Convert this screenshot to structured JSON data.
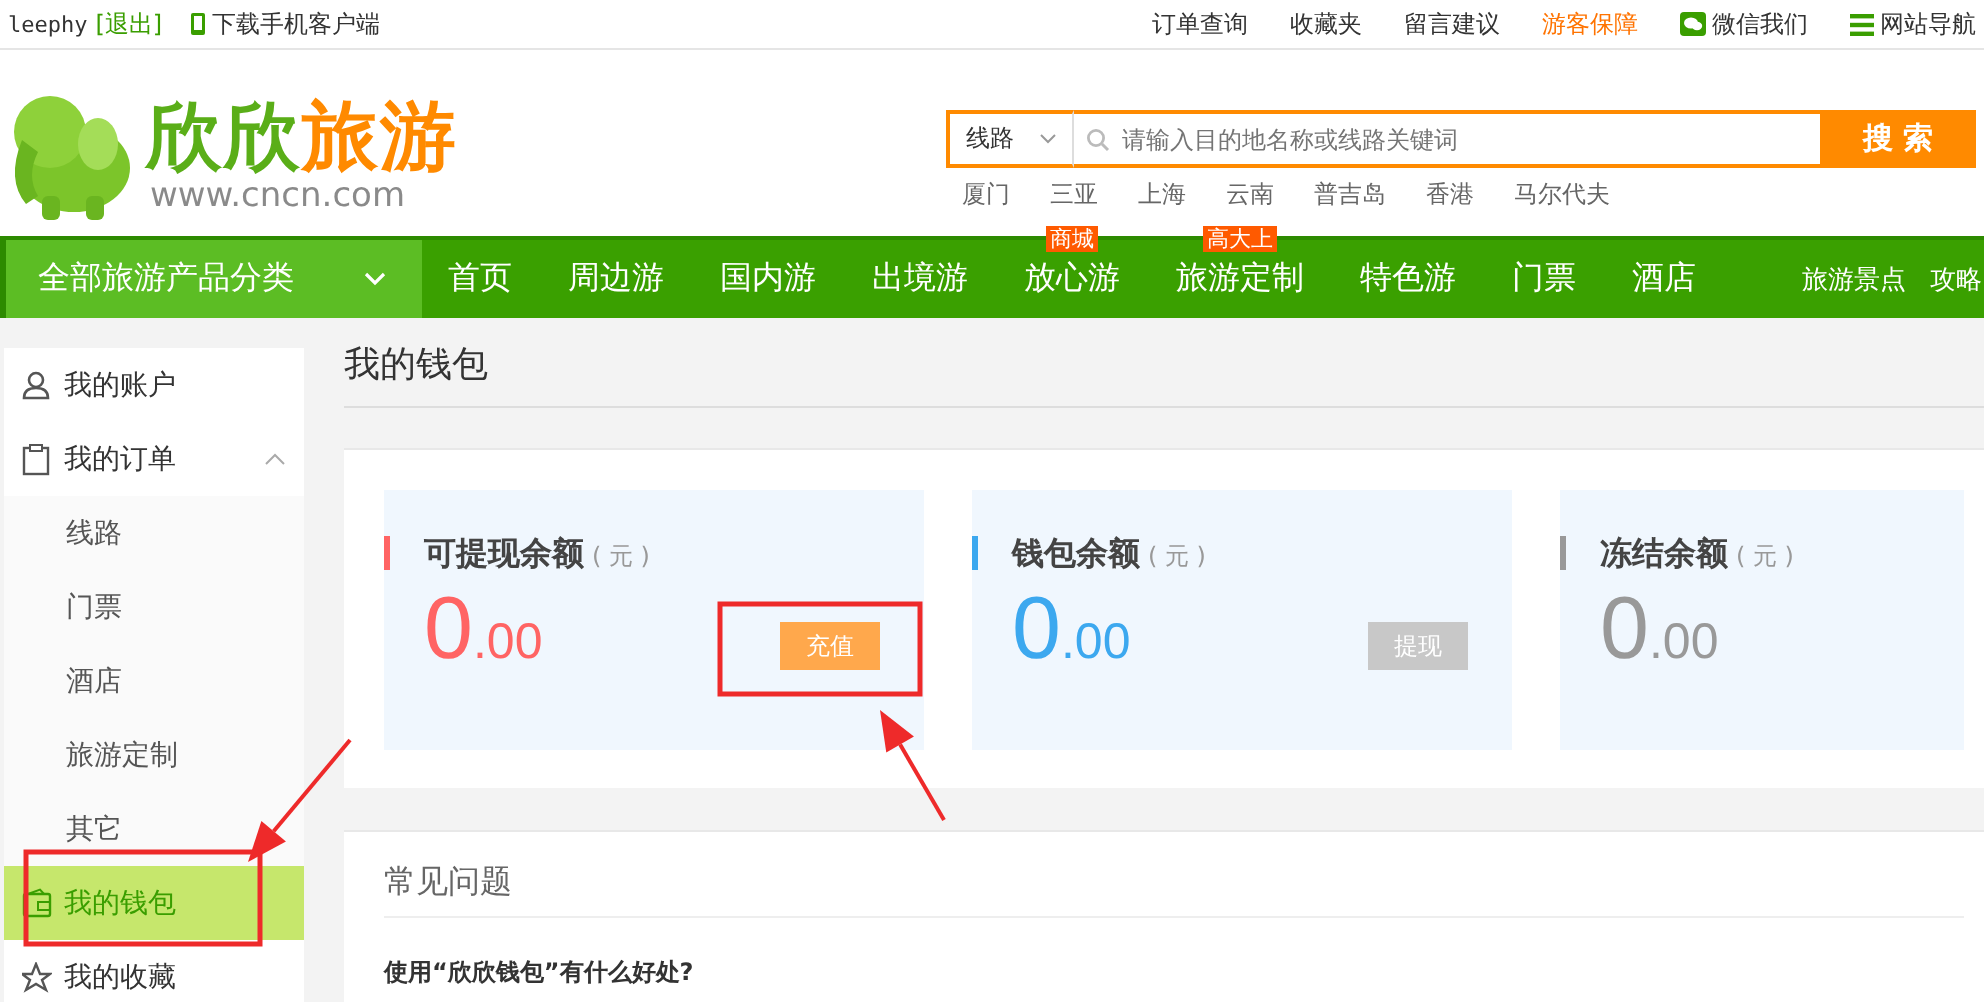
{
  "top_bar": {
    "username": "leephy",
    "logout": "[退出]",
    "app_download": "下载手机客户端",
    "links": [
      {
        "label": "订单查询",
        "kind": "plain"
      },
      {
        "label": "收藏夹",
        "kind": "plain"
      },
      {
        "label": "留言建议",
        "kind": "plain"
      },
      {
        "label": "游客保障",
        "kind": "highlight"
      },
      {
        "label": "微信我们",
        "kind": "wechat"
      },
      {
        "label": "网站导航",
        "kind": "menu"
      }
    ]
  },
  "header": {
    "logo": {
      "title_a": "欣欣",
      "title_b": "旅游",
      "domain": "www.cncn.com"
    },
    "search": {
      "category": "线路",
      "placeholder": "请输入目的地名称或线路关键词",
      "button": "搜 索"
    },
    "hot_words": [
      "厦门",
      "三亚",
      "上海",
      "云南",
      "普吉岛",
      "香港",
      "马尔代夫"
    ]
  },
  "nav": {
    "category_menu": "全部旅游产品分类",
    "items": [
      {
        "label": "首页"
      },
      {
        "label": "周边游"
      },
      {
        "label": "国内游"
      },
      {
        "label": "出境游"
      },
      {
        "label": "放心游",
        "badge": "商城"
      },
      {
        "label": "旅游定制",
        "badge": "高大上"
      },
      {
        "label": "特色游"
      },
      {
        "label": "门票"
      },
      {
        "label": "酒店"
      }
    ],
    "right_items": [
      "旅游景点",
      "攻略"
    ]
  },
  "sidebar": {
    "items": [
      {
        "label": "我的账户",
        "selected": false
      },
      {
        "label": "我的订单",
        "selected": false,
        "expanded": true,
        "children": [
          {
            "label": "线路",
            "selected": false
          },
          {
            "label": "门票",
            "selected": false
          },
          {
            "label": "酒店",
            "selected": false
          },
          {
            "label": "旅游定制",
            "selected": false
          },
          {
            "label": "其它",
            "selected": false
          }
        ]
      },
      {
        "label": "我的钱包",
        "selected": true
      },
      {
        "label": "我的收藏",
        "selected": false
      }
    ]
  },
  "wallet": {
    "title": "我的钱包",
    "balances": [
      {
        "label": "可提现余额",
        "unit": "( 元 )",
        "integer": "0",
        "decimal": ".00",
        "color": "#ff6464",
        "button": "充值",
        "button_disabled": false
      },
      {
        "label": "钱包余额",
        "unit": "( 元 )",
        "integer": "0",
        "decimal": ".00",
        "color": "#3ca8ef",
        "button": "提现",
        "button_disabled": true
      },
      {
        "label": "冻结余额",
        "unit": "( 元 )",
        "integer": "0",
        "decimal": ".00",
        "color": "#999999"
      }
    ]
  },
  "faq": {
    "title": "常见问题",
    "questions": [
      "使用“欣欣钱包”有什么好处?"
    ]
  },
  "annotations": [
    {
      "kind": "box"
    },
    {
      "kind": "box"
    },
    {
      "kind": "arrow"
    },
    {
      "kind": "arrow"
    }
  ]
}
